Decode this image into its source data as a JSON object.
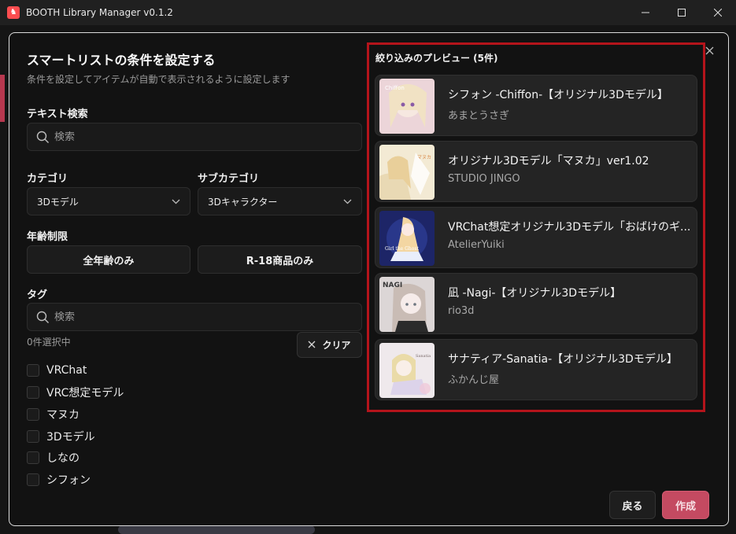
{
  "window": {
    "title": "BOOTH Library Manager v0.1.2",
    "controls": [
      "minimize-icon",
      "maximize-icon",
      "close-icon"
    ]
  },
  "dialog": {
    "title": "スマートリストの条件を設定する",
    "subtitle": "条件を設定してアイテムが自動で表示されるように設定します",
    "text_search": {
      "label": "テキスト検索",
      "placeholder": "検索"
    },
    "category": {
      "label": "カテゴリ",
      "value": "3Dモデル"
    },
    "subcategory": {
      "label": "サブカテゴリ",
      "value": "3Dキャラクター"
    },
    "age": {
      "label": "年齢制限",
      "all_ages": "全年齢のみ",
      "r18": "R-18商品のみ"
    },
    "tags": {
      "label": "タグ",
      "placeholder": "検索",
      "selected_count": "0件選択中",
      "clear_label": "クリア",
      "items": [
        "VRChat",
        "VRC想定モデル",
        "マヌカ",
        "3Dモデル",
        "しなの",
        "シフォン"
      ]
    },
    "preview": {
      "title": "絞り込みのプレビュー (5件)",
      "items": [
        {
          "title": "シフォン -Chiffon-【オリジナル3Dモデル】",
          "author": "あまとうさぎ",
          "thumb_color": "#e9c9cf",
          "thumb_text": "Chiffon"
        },
        {
          "title": "オリジナル3Dモデル「マヌカ」ver1.02",
          "author": "STUDIO JINGO",
          "thumb_color": "#efe3c6",
          "thumb_text": "マヌカ"
        },
        {
          "title": "VRChat想定オリジナル3Dモデル「おばけのギ...",
          "author": "AtelierYuiki",
          "thumb_color": "#1e2a6b",
          "thumb_text": "Girl the Ghost"
        },
        {
          "title": "凪 -Nagi-【オリジナル3Dモデル】",
          "author": "rio3d",
          "thumb_color": "#d8d2d2",
          "thumb_text": "NAGI"
        },
        {
          "title": "サナティア-Sanatia-【オリジナル3Dモデル】",
          "author": "ふかんじ屋",
          "thumb_color": "#ece6ea",
          "thumb_text": "Sanatia"
        }
      ]
    },
    "footer": {
      "back": "戻る",
      "create": "作成"
    }
  },
  "colors": {
    "accent": "#c44a61",
    "highlight_border": "#b4141b",
    "app_icon": "#fc4d50"
  }
}
